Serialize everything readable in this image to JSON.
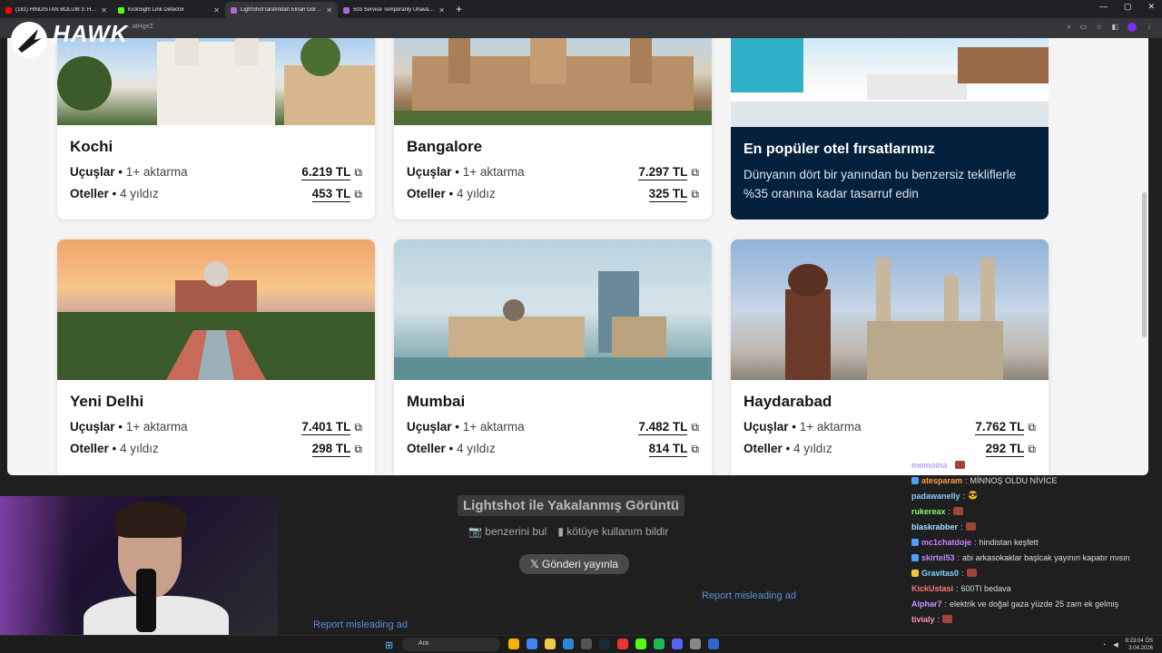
{
  "browser": {
    "tabs": [
      {
        "title": "(181) HİNDİSTAN BÖLÜM 3: HIN...",
        "icon": "youtube-icon",
        "color": "#ff0000",
        "active": false
      },
      {
        "title": "KickSight Link Detector",
        "icon": "kick-icon",
        "color": "#53fc18",
        "active": false
      },
      {
        "title": "LightShot tarafından Ekran Görüntüsü",
        "icon": "lightshot-icon",
        "color": "#b565d8",
        "active": true
      },
      {
        "title": "503 Service Temporarily Unavailable",
        "icon": "lightshot-icon",
        "color": "#b565d8",
        "active": false
      }
    ],
    "url": "...atHgeZ"
  },
  "overlay_logo": {
    "name": "HAWK",
    "sub": "SIMDI SAIS"
  },
  "cards_top": [
    {
      "city": "Kochi",
      "flights_label": "Uçuşlar",
      "flights_detail": "1+ aktarma",
      "flights_price": "6.219 TL",
      "hotels_label": "Oteller",
      "hotels_detail": "4 yıldız",
      "hotels_price": "453 TL"
    },
    {
      "city": "Bangalore",
      "flights_label": "Uçuşlar",
      "flights_detail": "1+ aktarma",
      "flights_price": "7.297 TL",
      "hotels_label": "Oteller",
      "hotels_detail": "4 yıldız",
      "hotels_price": "325 TL"
    }
  ],
  "promo": {
    "title": "En popüler otel fırsatlarımız",
    "text": "Dünyanın dört bir yanından bu benzersiz tekliflerle %35 oranına kadar tasarruf edin"
  },
  "cards_bottom": [
    {
      "city": "Yeni Delhi",
      "flights_label": "Uçuşlar",
      "flights_detail": "1+ aktarma",
      "flights_price": "7.401 TL",
      "hotels_label": "Oteller",
      "hotels_detail": "4 yıldız",
      "hotels_price": "298 TL"
    },
    {
      "city": "Mumbai",
      "flights_label": "Uçuşlar",
      "flights_detail": "1+ aktarma",
      "flights_price": "7.482 TL",
      "hotels_label": "Oteller",
      "hotels_detail": "4 yıldız",
      "hotels_price": "814 TL"
    },
    {
      "city": "Haydarabad",
      "flights_label": "Uçuşlar",
      "flights_detail": "1+ aktarma",
      "flights_price": "7.762 TL",
      "hotels_label": "Oteller",
      "hotels_detail": "4 yıldız",
      "hotels_price": "292 TL"
    }
  ],
  "lightshot": {
    "title": "Lightshot ile Yakalanmış Görüntü",
    "find_similar": "benzerini bul",
    "report_abuse": "kötüye kullanım bildir",
    "tweet": "Gönderi yayınla",
    "report_ad_1": "Report misleading ad",
    "report_ad_2": "Report misleading ad"
  },
  "chat": [
    {
      "user": "memoina",
      "text": "",
      "color": "#b9a0ff"
    },
    {
      "user": "atesparam",
      "text": "MİNNOŞ OLDU NİVİCE",
      "color": "#ff9f43"
    },
    {
      "user": "padawanelly",
      "text": "",
      "color": "#8cc6ff"
    },
    {
      "user": "rukereax",
      "text": "",
      "color": "#7cff6b"
    },
    {
      "user": "blaskrabber",
      "text": "",
      "color": "#9fe0ff"
    },
    {
      "user": "mc1chatdoje",
      "text": "hindistan keşfett",
      "color": "#d080ff"
    },
    {
      "user": "skirtel53",
      "text": "abi arkasokaklar başlcak yayının kapatır mısın",
      "color": "#c08cff"
    },
    {
      "user": "Gravitas0",
      "text": "",
      "color": "#7fd7ff"
    },
    {
      "user": "KickUstasi",
      "text": "600TI bedava",
      "color": "#ff7a7a"
    },
    {
      "user": "Alphar7",
      "text": "elektrik ve doğal gaza yüzde 25 zam ek gelmiş",
      "color": "#c89bff"
    },
    {
      "user": "tivialy",
      "text": "",
      "color": "#ff8fb0"
    }
  ],
  "taskbar": {
    "search": "Ara",
    "time": "8:23:04 ÖS",
    "date": "3.04.2026"
  }
}
